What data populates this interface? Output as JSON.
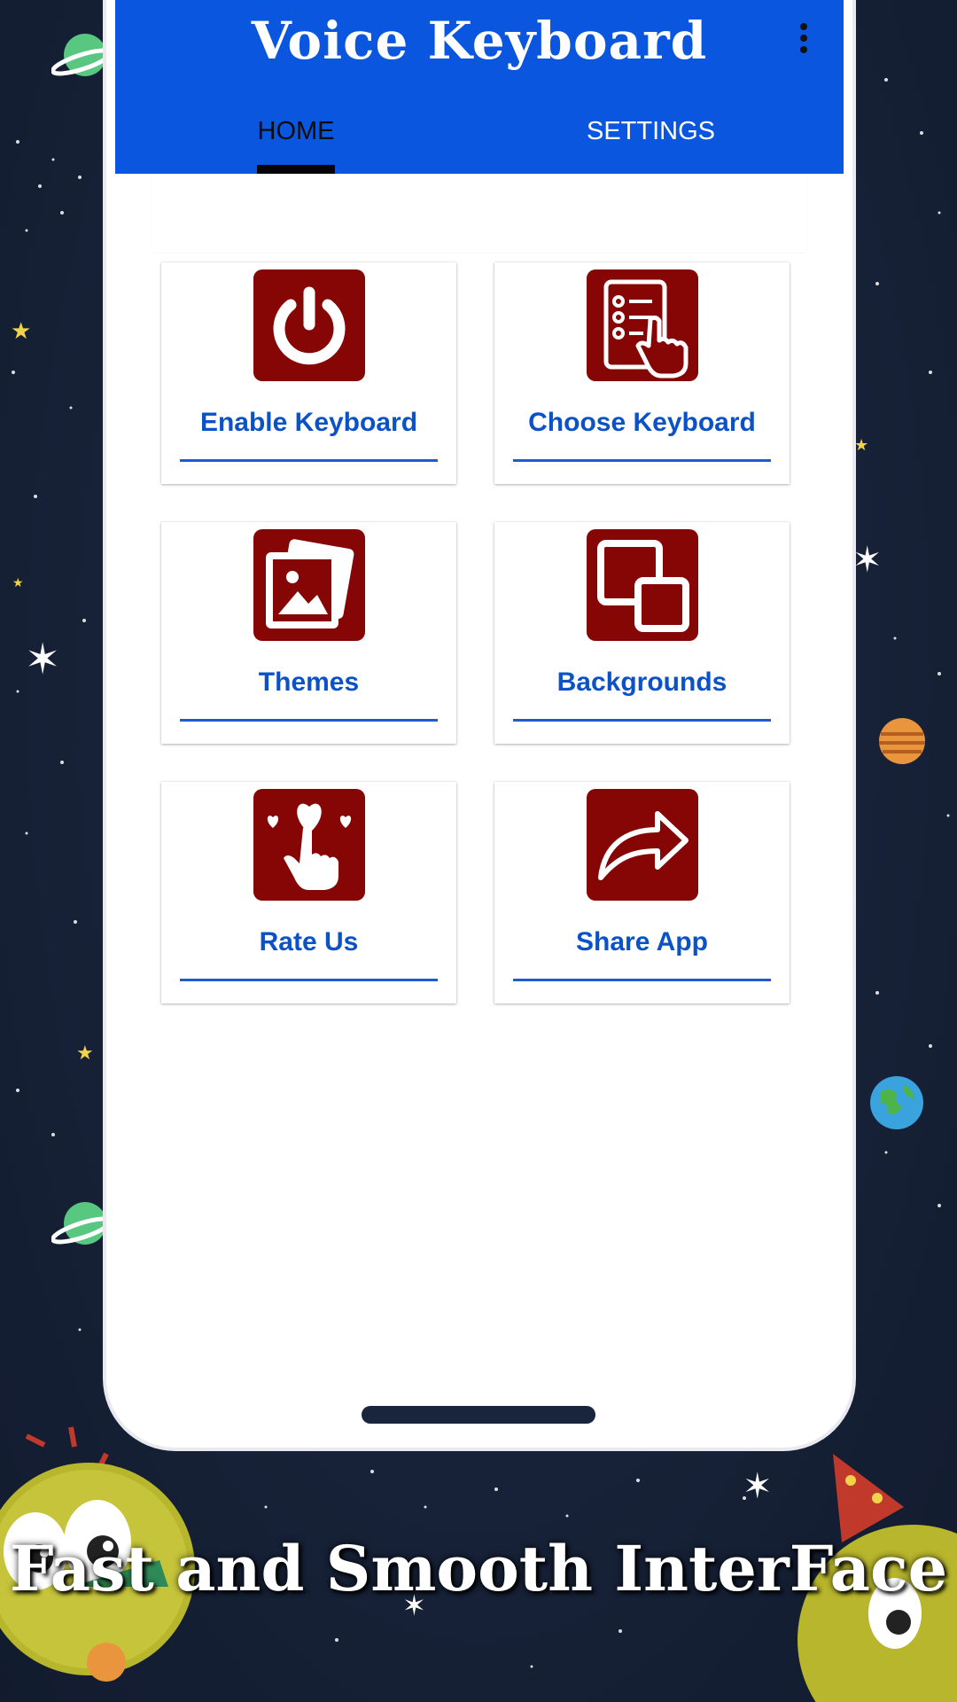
{
  "app": {
    "title": "Voice Keyboard"
  },
  "tabs": {
    "home": "HOME",
    "settings": "SETTINGS",
    "selected": "HOME"
  },
  "menu": {
    "icon": "more-vertical-icon"
  },
  "cards": [
    {
      "label": "Enable Keyboard",
      "icon": "power-icon"
    },
    {
      "label": "Choose Keyboard",
      "icon": "checklist-tap-icon"
    },
    {
      "label": "Themes",
      "icon": "image-stack-icon"
    },
    {
      "label": "Backgrounds",
      "icon": "layered-squares-icon"
    },
    {
      "label": "Rate Us",
      "icon": "hearts-tap-icon"
    },
    {
      "label": "Share App",
      "icon": "share-arrow-icon"
    }
  ],
  "caption": "Fast and Smooth InterFace",
  "colors": {
    "appbar": "#0a56df",
    "icon_bg": "#860606",
    "label": "#0c52c7",
    "background": "#172238"
  }
}
